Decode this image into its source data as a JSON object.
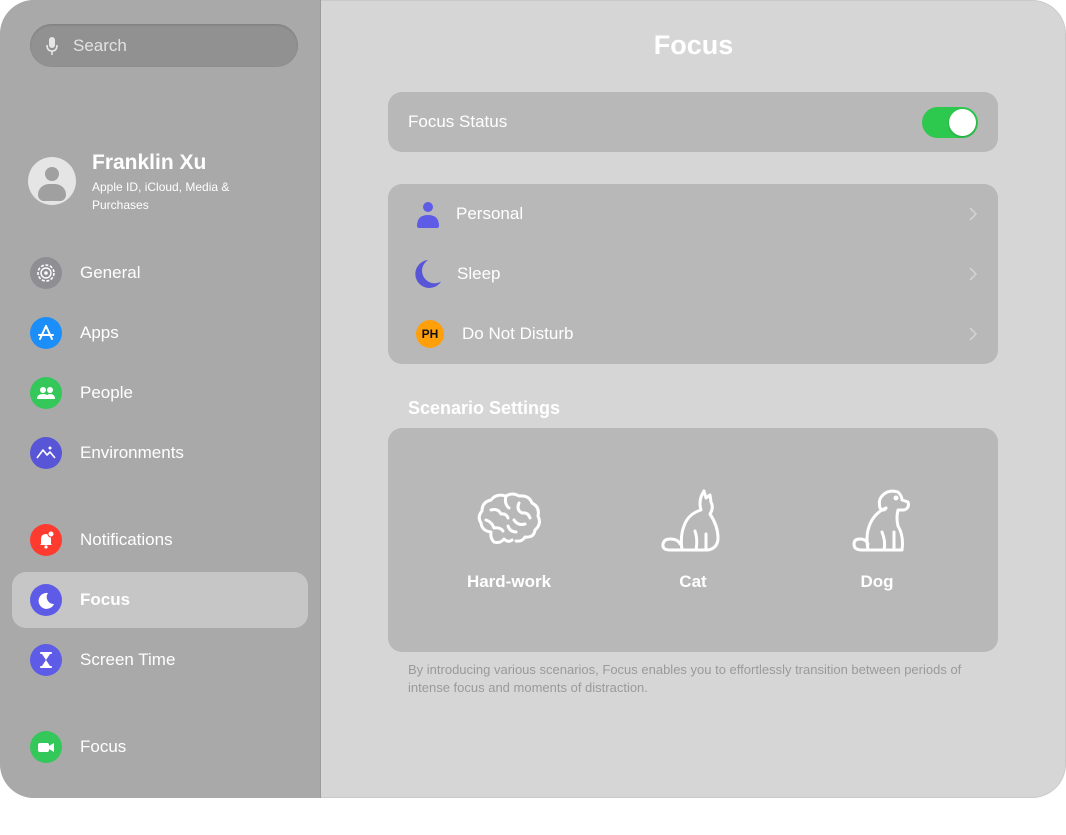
{
  "search": {
    "placeholder": "Search",
    "icon": "mic-icon"
  },
  "profile": {
    "name": "Franklin Xu",
    "subtitle": "Apple ID, iCloud, Media & Purchases"
  },
  "sidebar": {
    "items": [
      {
        "label": "General",
        "icon": "gear-icon",
        "color": "#8e8e93",
        "active": false
      },
      {
        "label": "Apps",
        "icon": "app-store-icon",
        "color": "#1c8ef9",
        "active": false
      },
      {
        "label": "People",
        "icon": "people-icon",
        "color": "#34c759",
        "active": false
      },
      {
        "label": "Environments",
        "icon": "mountains-icon",
        "color": "#5856d6",
        "active": false
      },
      {
        "label": "Notifications",
        "icon": "bell-icon",
        "color": "#ff3b30",
        "active": false
      },
      {
        "label": "Focus",
        "icon": "moon-icon",
        "color": "#5e5ce6",
        "active": true
      },
      {
        "label": "Screen Time",
        "icon": "hourglass-icon",
        "color": "#5e5ce6",
        "active": false
      },
      {
        "label": "Focus",
        "icon": "video-camera-icon",
        "color": "#34c759",
        "active": false
      }
    ]
  },
  "main": {
    "title": "Focus",
    "focus_status": {
      "label": "Focus Status",
      "on": true,
      "toggle_color": "#2dc84e"
    },
    "modes": [
      {
        "label": "Personal",
        "icon": "person-icon",
        "color": "#5e5ce6"
      },
      {
        "label": "Sleep",
        "icon": "moon-icon",
        "color": "#5856d6"
      },
      {
        "label": "Do Not Disturb",
        "icon": "ph-badge-icon",
        "badge_text": "PH",
        "color": "#ff9f0a"
      }
    ],
    "scenario_section_title": "Scenario Settings",
    "scenarios": [
      {
        "label": "Hard-work",
        "icon": "brain-icon"
      },
      {
        "label": "Cat",
        "icon": "cat-icon"
      },
      {
        "label": "Dog",
        "icon": "dog-icon"
      }
    ],
    "footnote": "By introducing various scenarios, Focus enables you to effortlessly transition between periods of intense focus and moments of distraction."
  }
}
